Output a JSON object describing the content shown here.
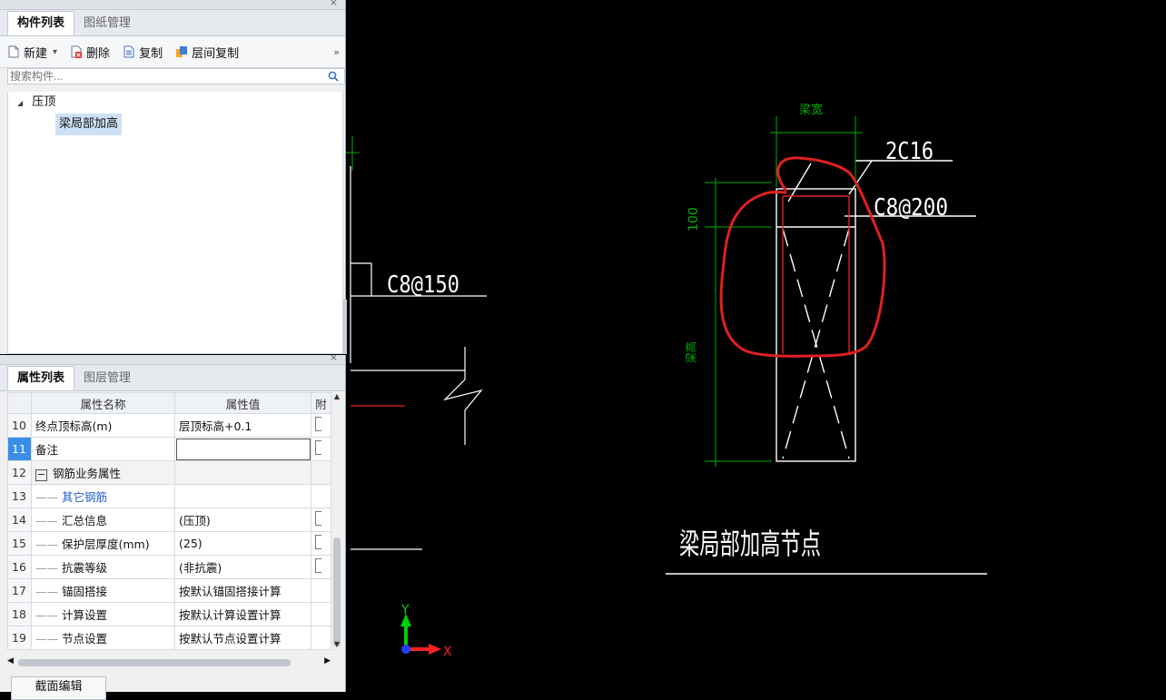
{
  "component_panel": {
    "close_glyph": "×",
    "tabs": [
      "构件列表",
      "图纸管理"
    ],
    "toolbar": {
      "new_label": "新建",
      "new_dropdown": "▾",
      "delete_label": "删除",
      "copy_label": "复制",
      "floor_copy_label": "层间复制",
      "more": "»"
    },
    "search_placeholder": "搜索构件...",
    "tree": {
      "parent_label": "压顶",
      "expand_glyph": "◢",
      "child_label": "梁局部加高"
    }
  },
  "property_panel": {
    "close_glyph": "×",
    "tabs": [
      "属性列表",
      "图层管理"
    ],
    "columns": [
      "属性名称",
      "属性值",
      "附"
    ],
    "rows": [
      {
        "num": "10",
        "name": "终点顶标高(m)",
        "value": "层顶标高+0.1",
        "check": true
      },
      {
        "num": "11",
        "name": "备注",
        "value": "",
        "check": true
      },
      {
        "num": "12",
        "name": "钢筋业务属性",
        "value": "",
        "check": false
      },
      {
        "num": "13",
        "name": "其它钢筋",
        "value": "",
        "check": false
      },
      {
        "num": "14",
        "name": "汇总信息",
        "value": "(压顶)",
        "check": true
      },
      {
        "num": "15",
        "name": "保护层厚度(mm)",
        "value": "(25)",
        "check": true
      },
      {
        "num": "16",
        "name": "抗震等级",
        "value": "(非抗震)",
        "check": true
      },
      {
        "num": "17",
        "name": "锚固搭接",
        "value": "按默认锚固搭接计算",
        "check": false
      },
      {
        "num": "18",
        "name": "计算设置",
        "value": "按默认计算设置计算",
        "check": false
      },
      {
        "num": "19",
        "name": "节点设置",
        "value": "按默认节点设置计算",
        "check": false
      }
    ],
    "collapse_glyph": "−",
    "bottom_button": "截面编辑"
  },
  "cad": {
    "labels": {
      "rebar_left": "C8@150",
      "rebar_top": "2C16",
      "rebar_stirrup": "C8@200",
      "dim_width": "梁宽",
      "dim_100": "100",
      "dim_height": "梁高",
      "title": "梁局部加高节点",
      "axis_y": "Y",
      "axis_x": "X"
    },
    "colors": {
      "line": "#ffffff",
      "dim": "#00b000",
      "markup": "#e02020",
      "axis_y": "#00d000",
      "axis_x": "#ff2020",
      "origin": "#2040ff"
    }
  }
}
